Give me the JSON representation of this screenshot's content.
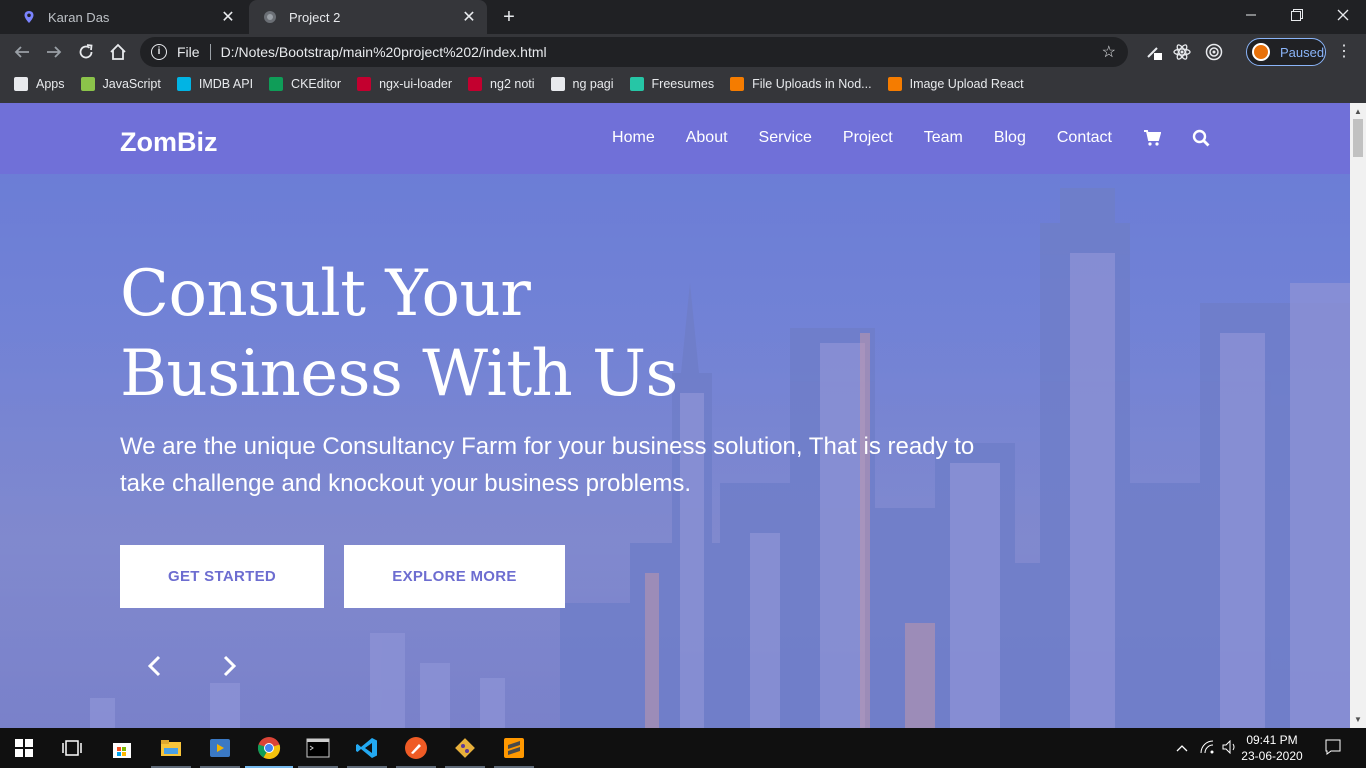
{
  "browser": {
    "tabs": [
      {
        "title": "Karan Das",
        "active": false
      },
      {
        "title": "Project 2",
        "active": true
      }
    ],
    "omnibox": {
      "scheme": "File",
      "url": "D:/Notes/Bootstrap/main%20project%202/index.html"
    },
    "profile_status": "Paused",
    "bookmarks": [
      {
        "label": "Apps",
        "color": "#e8eaed"
      },
      {
        "label": "JavaScript",
        "color": "#8bc34a"
      },
      {
        "label": "IMDB API",
        "color": "#01b4e4"
      },
      {
        "label": "CKEditor",
        "color": "#0f9d58"
      },
      {
        "label": "ngx-ui-loader",
        "color": "#c3002f"
      },
      {
        "label": "ng2 noti",
        "color": "#c3002f"
      },
      {
        "label": "ng pagi",
        "color": "#e8eaed"
      },
      {
        "label": "Freesumes",
        "color": "#26c6a6"
      },
      {
        "label": "File Uploads in Nod...",
        "color": "#f57c00"
      },
      {
        "label": "Image Upload React",
        "color": "#f57c00"
      }
    ]
  },
  "site": {
    "logo": "ZomBiz",
    "nav": [
      "Home",
      "About",
      "Service",
      "Project",
      "Team",
      "Blog",
      "Contact"
    ],
    "headline_line1": "Consult Your",
    "headline_line2": "Business With Us",
    "subtitle": "We are the unique Consultancy Farm for your business solution, That is ready to take challenge and knockout your business problems.",
    "buttons": {
      "primary": "GET STARTED",
      "secondary": "EXPLORE MORE"
    },
    "colors": {
      "nav_bg": "#7070d8",
      "button_text": "#6d6dd0"
    }
  },
  "taskbar": {
    "time": "09:41 PM",
    "date": "23-06-2020"
  }
}
